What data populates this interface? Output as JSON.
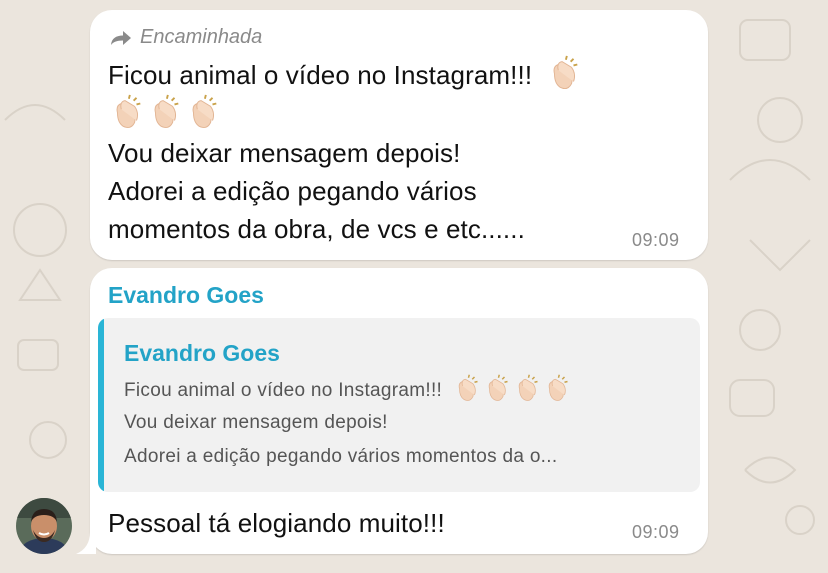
{
  "forwarded_message": {
    "forward_label": "Encaminhada",
    "line1": "Ficou animal o vídeo no Instagram!!!",
    "line2": "Vou deixar mensagem depois!",
    "line3": "Adorei a edição pegando vários",
    "line4": "momentos da obra, de vcs e etc......",
    "time": "09:09"
  },
  "reply_message": {
    "sender_name": "Evandro Goes",
    "quoted": {
      "sender_name": "Evandro Goes",
      "line1": "Ficou animal o vídeo no Instagram!!!",
      "line2": "Vou deixar mensagem depois!",
      "line3": "Adorei a edição pegando vários momentos da o..."
    },
    "text": "Pessoal tá elogiando muito!!!",
    "time": "09:09"
  },
  "icons": {
    "forward": "forward-arrow-icon",
    "emoji": "clapping-hands-emoji",
    "avatar": "user-avatar"
  },
  "colors": {
    "chat_background": "#ebe5dd",
    "bubble": "#ffffff",
    "sender_name": "#23a3c7",
    "quote_bar": "#2ab5d6",
    "quote_background": "#f1f1f1",
    "timestamp": "#8a8a8a"
  }
}
